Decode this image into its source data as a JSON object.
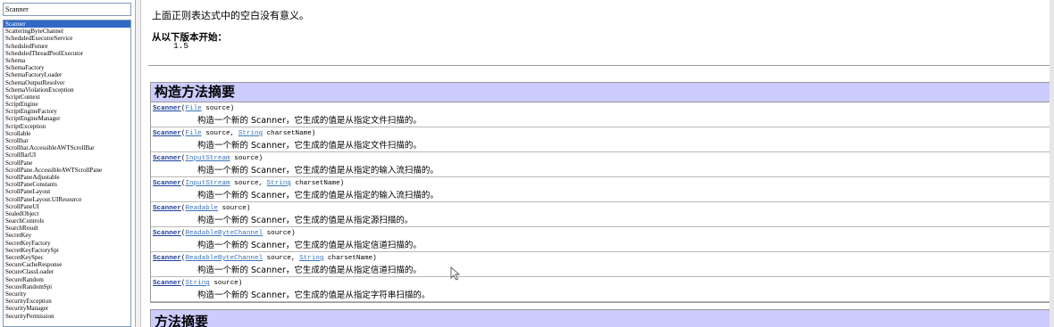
{
  "search": {
    "value": "Scanner"
  },
  "index": {
    "items": [
      {
        "label": "Scanner",
        "selected": true
      },
      {
        "label": "ScatteringByteChannel"
      },
      {
        "label": "ScheduledExecutorService"
      },
      {
        "label": "ScheduledFuture"
      },
      {
        "label": "ScheduledThreadPoolExecutor"
      },
      {
        "label": "Schema"
      },
      {
        "label": "SchemaFactory"
      },
      {
        "label": "SchemaFactoryLoader"
      },
      {
        "label": "SchemaOutputResolver"
      },
      {
        "label": "SchemaViolationException"
      },
      {
        "label": "ScriptContext"
      },
      {
        "label": "ScriptEngine"
      },
      {
        "label": "ScriptEngineFactory"
      },
      {
        "label": "ScriptEngineManager"
      },
      {
        "label": "ScriptException"
      },
      {
        "label": "Scrollable"
      },
      {
        "label": "Scrollbar"
      },
      {
        "label": "Scrollbar.AccessibleAWTScrollBar"
      },
      {
        "label": "ScrollBarUI"
      },
      {
        "label": "ScrollPane"
      },
      {
        "label": "ScrollPane.AccessibleAWTScrollPane"
      },
      {
        "label": "ScrollPaneAdjustable"
      },
      {
        "label": "ScrollPaneConstants"
      },
      {
        "label": "ScrollPaneLayout"
      },
      {
        "label": "ScrollPaneLayout.UIResource"
      },
      {
        "label": "ScrollPaneUI"
      },
      {
        "label": "SealedObject"
      },
      {
        "label": "SearchControls"
      },
      {
        "label": "SearchResult"
      },
      {
        "label": "SecretKey"
      },
      {
        "label": "SecretKeyFactory"
      },
      {
        "label": "SecretKeyFactorySpi"
      },
      {
        "label": "SecretKeySpec"
      },
      {
        "label": "SecureCacheResponse"
      },
      {
        "label": "SecureClassLoader"
      },
      {
        "label": "SecureRandom"
      },
      {
        "label": "SecureRandomSpi"
      },
      {
        "label": "Security"
      },
      {
        "label": "SecurityException"
      },
      {
        "label": "SecurityManager"
      },
      {
        "label": "SecurityPermission"
      }
    ]
  },
  "doc": {
    "intro": "上面正则表达式中的空白没有意义。",
    "since_label": "从以下版本开始：",
    "since_value": "1.5",
    "ctor_summary_title": "构造方法摘要",
    "method_summary_title": "方法摘要",
    "constructors": [
      {
        "name": "Scanner",
        "open": "(",
        "params": [
          {
            "type": "File",
            "rest": " source)"
          }
        ],
        "desc": "构造一个新的 Scanner，它生成的值是从指定文件扫描的。"
      },
      {
        "name": "Scanner",
        "open": "(",
        "params": [
          {
            "type": "File",
            "rest": " source, "
          },
          {
            "type": "String",
            "rest": " charsetName)"
          }
        ],
        "desc": "构造一个新的 Scanner，它生成的值是从指定文件扫描的。"
      },
      {
        "name": "Scanner",
        "open": "(",
        "params": [
          {
            "type": "InputStream",
            "rest": " source)"
          }
        ],
        "desc": "构造一个新的 Scanner，它生成的值是从指定的输入流扫描的。"
      },
      {
        "name": "Scanner",
        "open": "(",
        "params": [
          {
            "type": "InputStream",
            "rest": " source, "
          },
          {
            "type": "String",
            "rest": " charsetName)"
          }
        ],
        "desc": "构造一个新的 Scanner，它生成的值是从指定的输入流扫描的。"
      },
      {
        "name": "Scanner",
        "open": "(",
        "params": [
          {
            "type": "Readable",
            "rest": " source)"
          }
        ],
        "desc": "构造一个新的 Scanner，它生成的值是从指定源扫描的。"
      },
      {
        "name": "Scanner",
        "open": "(",
        "params": [
          {
            "type": "ReadableByteChannel",
            "rest": " source)"
          }
        ],
        "desc": "构造一个新的 Scanner，它生成的值是从指定信道扫描的。"
      },
      {
        "name": "Scanner",
        "open": "(",
        "params": [
          {
            "type": "ReadableByteChannel",
            "rest": " source, "
          },
          {
            "type": "String",
            "rest": " charsetName)"
          }
        ],
        "desc": "构造一个新的 Scanner，它生成的值是从指定信道扫描的。"
      },
      {
        "name": "Scanner",
        "open": "(",
        "params": [
          {
            "type": "String",
            "rest": " source)"
          }
        ],
        "desc": "构造一个新的 Scanner，它生成的值是从指定字符串扫描的。"
      }
    ]
  },
  "colors": {
    "selection": "#3169c6",
    "header_bg": "#ccccff",
    "link": "#1d3e99"
  },
  "icons": {
    "cursor": "mouse-pointer-icon"
  }
}
